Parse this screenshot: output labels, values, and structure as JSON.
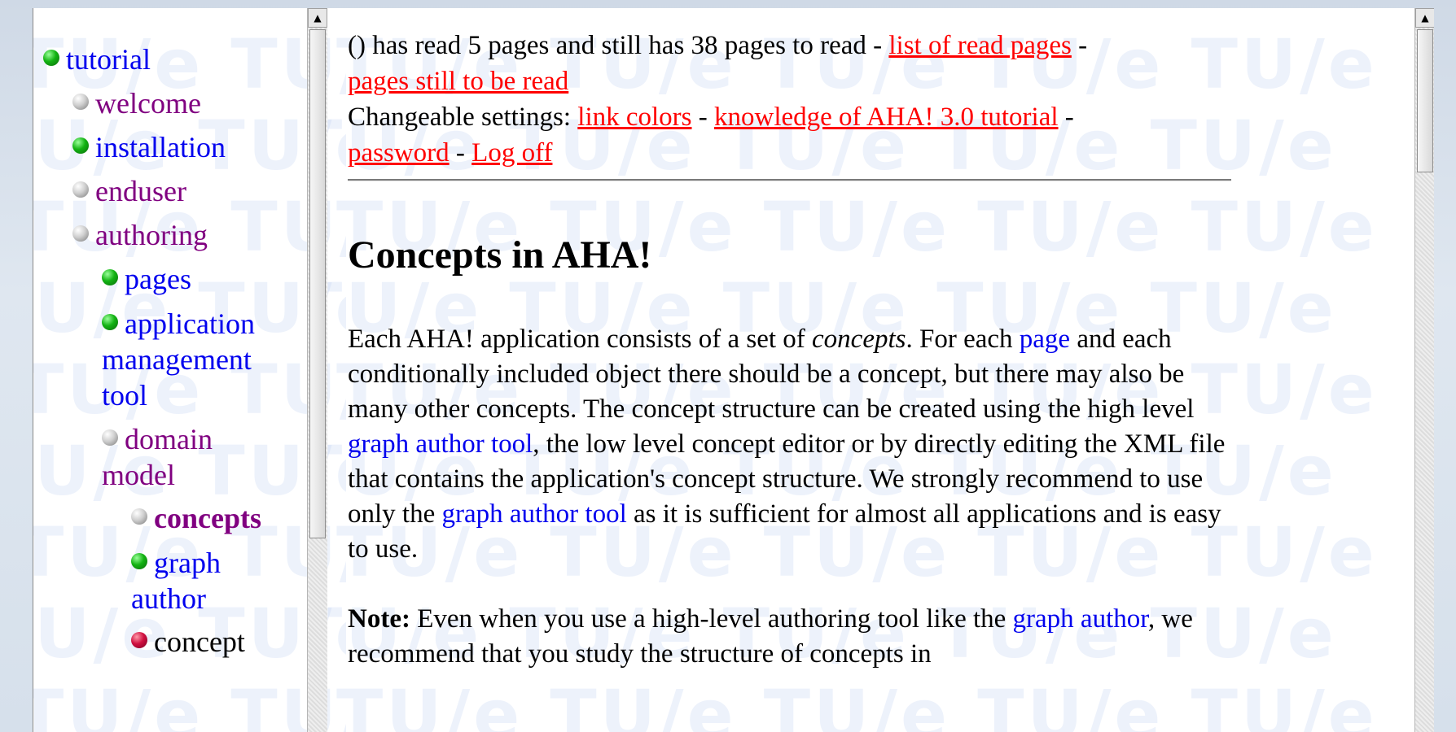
{
  "nav": {
    "items": [
      {
        "label": "tutorial",
        "bullet": "green",
        "indent": 0,
        "color": "blue"
      },
      {
        "label": "welcome",
        "bullet": "grey",
        "indent": 1,
        "color": "purple"
      },
      {
        "label": "installation",
        "bullet": "green",
        "indent": 1,
        "color": "blue"
      },
      {
        "label": "enduser",
        "bullet": "grey",
        "indent": 1,
        "color": "purple"
      },
      {
        "label": "authoring",
        "bullet": "grey",
        "indent": 1,
        "color": "purple"
      },
      {
        "label": "pages",
        "bullet": "green",
        "indent": 2,
        "color": "blue"
      },
      {
        "label": "application management tool",
        "bullet": "green",
        "indent": 2,
        "color": "blue"
      },
      {
        "label": "domain model",
        "bullet": "grey",
        "indent": 2,
        "color": "purple"
      },
      {
        "label": "concepts",
        "bullet": "grey",
        "indent": 3,
        "color": "purple",
        "bold": true
      },
      {
        "label": "graph author",
        "bullet": "green",
        "indent": 3,
        "color": "blue"
      },
      {
        "label": "concept",
        "bullet": "red",
        "indent": 3,
        "color": "black"
      }
    ]
  },
  "header": {
    "status_prefix": "() has read 5 pages and still has 38 pages to read - ",
    "link_read": "list of read pages",
    "sep1": " - ",
    "link_unread": "pages still to be read",
    "settings_prefix": "Changeable settings: ",
    "link_colors": "link colors",
    "sep2": " - ",
    "link_knowledge": "knowledge of AHA! 3.0 tutorial",
    "sep3": " - ",
    "link_password": "password",
    "sep4": " - ",
    "link_logoff": "Log off"
  },
  "main": {
    "title": "Concepts in AHA!",
    "para1": {
      "t1": "Each AHA! application consists of a set of ",
      "em": "concepts",
      "t2": ". For each ",
      "link_page": "page",
      "t3": " and each conditionally included object there should be a concept, but there may also be many other concepts. The concept structure can be created using the high level ",
      "link_gat1": "graph author tool",
      "t4": ", the low level concept editor or by directly editing the XML file that contains the application's concept structure. We strongly recommend to use only the ",
      "link_gat2": "graph author tool",
      "t5": " as it is sufficient for almost all applications and is easy to use."
    },
    "para2": {
      "label": "Note:",
      "t1": " Even when you use a high-level authoring tool like the ",
      "link_graph": "graph author",
      "t2": ", we recommend that you study the structure of concepts in"
    }
  },
  "watermark": "TU/e TU/e TU/e TU/e TU/e",
  "colors": {
    "visited_link": "#800080",
    "unvisited_link": "#0000ee",
    "settings_link": "#ff0000"
  }
}
